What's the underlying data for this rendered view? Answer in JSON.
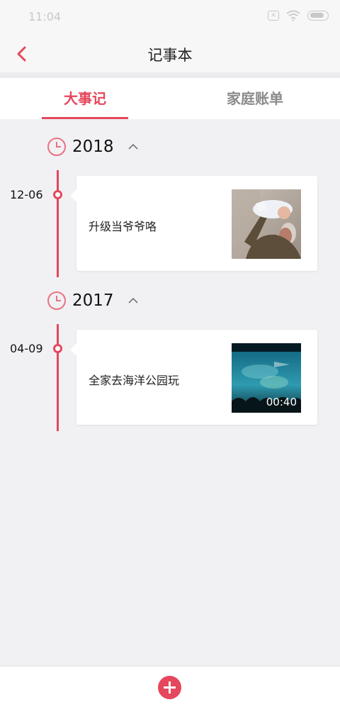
{
  "status_bar": {
    "time": "11:04"
  },
  "header": {
    "title": "记事本"
  },
  "tabs": [
    {
      "label": "大事记",
      "active": true
    },
    {
      "label": "家庭账单",
      "active": false
    }
  ],
  "timeline": [
    {
      "year": "2018",
      "entries": [
        {
          "date": "12-06",
          "text": "升级当爷爷咯",
          "media": "photo",
          "thumbnail": "grandfather-lifting-baby-photo"
        }
      ]
    },
    {
      "year": "2017",
      "entries": [
        {
          "date": "04-09",
          "text": "全家去海洋公园玩",
          "media": "video",
          "duration": "00:40",
          "thumbnail": "aquarium-video-thumbnail"
        }
      ]
    }
  ],
  "colors": {
    "accent": "#e5475c",
    "background": "#f1f1f3"
  },
  "icons": [
    "back-arrow-icon",
    "clock-icon",
    "chevron-up-icon",
    "add-icon"
  ]
}
